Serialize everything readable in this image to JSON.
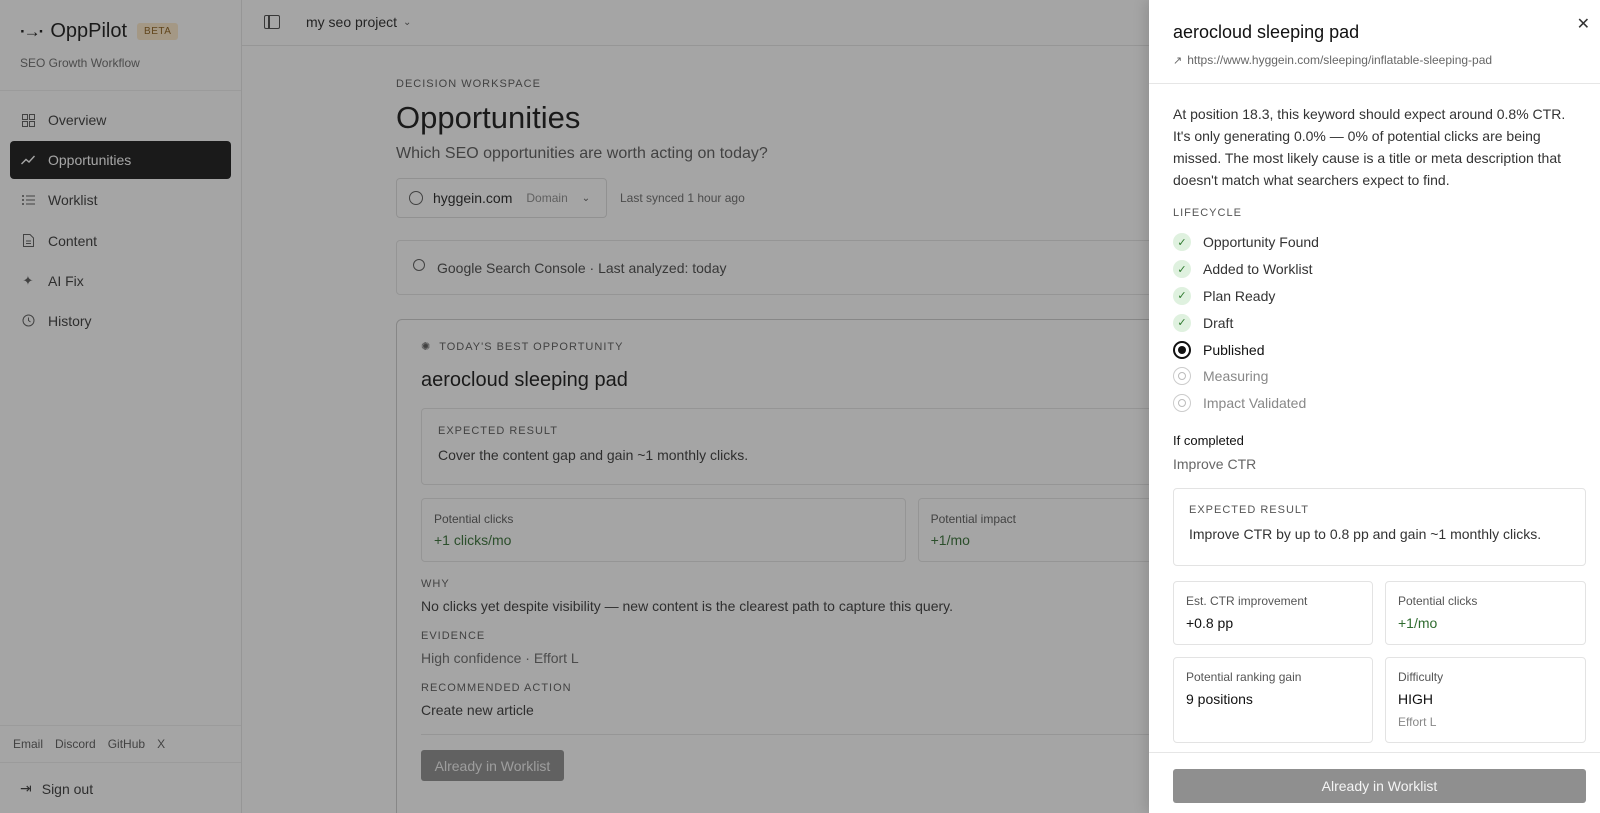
{
  "brand": {
    "name": "OppPilot",
    "badge": "BETA",
    "subtitle": "SEO Growth Workflow"
  },
  "sidebar": {
    "items": [
      {
        "label": "Overview",
        "icon": "grid-icon"
      },
      {
        "label": "Opportunities",
        "icon": "trend-icon"
      },
      {
        "label": "Worklist",
        "icon": "list-icon"
      },
      {
        "label": "Content",
        "icon": "document-icon"
      },
      {
        "label": "AI Fix",
        "icon": "sparkle-icon"
      },
      {
        "label": "History",
        "icon": "history-icon"
      }
    ],
    "footer_links": [
      "Email",
      "Discord",
      "GitHub",
      "X"
    ],
    "sign_out": "Sign out"
  },
  "topbar": {
    "project": "my seo project"
  },
  "main": {
    "eyebrow": "DECISION WORKSPACE",
    "title": "Opportunities",
    "subtitle": "Which SEO opportunities are worth acting on today?",
    "domain": {
      "value": "hyggein.com",
      "type": "Domain"
    },
    "synced": "Last synced 1 hour ago",
    "source": "Google Search Console · Last analyzed: today",
    "card": {
      "eyebrow": "TODAY'S BEST OPPORTUNITY",
      "title": "aerocloud sleeping pad",
      "expected_label": "EXPECTED RESULT",
      "expected_text": "Cover the content gap and gain ~1 monthly clicks.",
      "metric1_label": "Potential clicks",
      "metric1_value": "+1 clicks/mo",
      "metric2_label": "Potential impact",
      "metric2_value": "+1/mo",
      "why_label": "WHY",
      "why_text": "No clicks yet despite visibility — new content is the clearest path to capture this query.",
      "evidence_label": "EVIDENCE",
      "evidence_text": "High confidence · Effort L",
      "action_label": "RECOMMENDED ACTION",
      "action_text": "Create new article",
      "button": "Already in Worklist"
    }
  },
  "drawer": {
    "title": "aerocloud sleeping pad",
    "url": "https://www.hyggein.com/sleeping/inflatable-sleeping-pad",
    "description": "At position 18.3, this keyword should expect around 0.8% CTR. It's only generating 0.0% — 0% of potential clicks are being missed. The most likely cause is a title or meta description that doesn't match what searchers expect to find.",
    "lifecycle_label": "LIFECYCLE",
    "lifecycle": [
      {
        "label": "Opportunity Found",
        "state": "done"
      },
      {
        "label": "Added to Worklist",
        "state": "done"
      },
      {
        "label": "Plan Ready",
        "state": "done"
      },
      {
        "label": "Draft",
        "state": "done"
      },
      {
        "label": "Published",
        "state": "current"
      },
      {
        "label": "Measuring",
        "state": "future"
      },
      {
        "label": "Impact Validated",
        "state": "future"
      }
    ],
    "if_completed_label": "If completed",
    "if_completed_value": "Improve CTR",
    "expected_label": "EXPECTED RESULT",
    "expected_text": "Improve CTR by up to 0.8 pp and gain ~1 monthly clicks.",
    "stats": {
      "ctr_label": "Est. CTR improvement",
      "ctr_value": "+0.8 pp",
      "clicks_label": "Potential clicks",
      "clicks_value": "+1/mo",
      "rank_label": "Potential ranking gain",
      "rank_value": "9 positions",
      "diff_label": "Difficulty",
      "diff_value": "HIGH",
      "diff_sub": "Effort L"
    },
    "button": "Already in Worklist"
  }
}
